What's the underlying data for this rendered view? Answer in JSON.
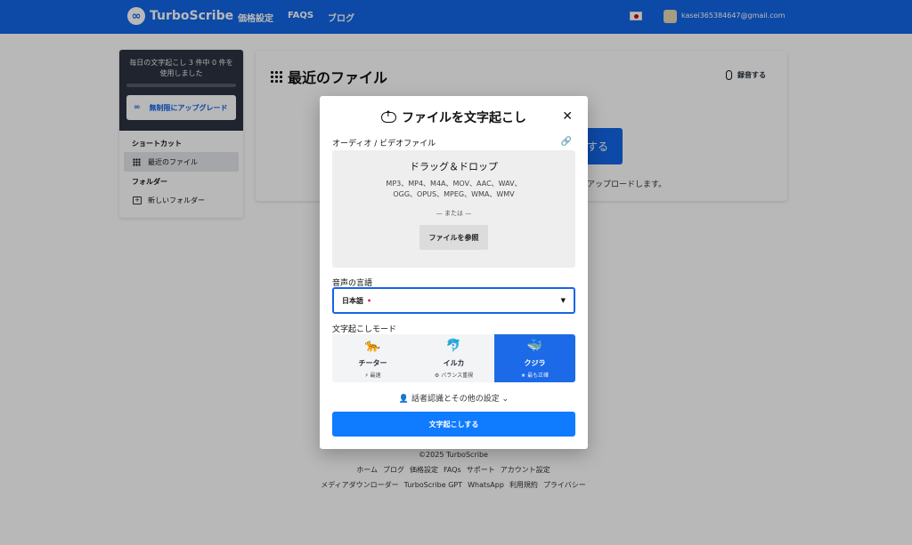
{
  "nav": {
    "brand": "TurboScribe",
    "links": [
      "価格設定",
      "FAQS",
      "ブログ"
    ],
    "email": "kasei365384647@gmail.com"
  },
  "sidebar": {
    "quota_text": "毎日の文字起こし 3 件中 0 件を使用しました",
    "upgrade_label": "無制限にアップグレード",
    "shortcuts_heading": "ショートカット",
    "recent_files": "最近のファイル",
    "folders_heading": "フォルダー",
    "new_folder": "新しいフォルダー"
  },
  "main": {
    "title": "最近のファイル",
    "record_label": "録音する",
    "upload_button_partial": "する",
    "upload_note_partial": "アップロードします。"
  },
  "footer": {
    "copyright": "©2025 TurboScribe",
    "row1": [
      "ホーム",
      "ブログ",
      "価格設定",
      "FAQs",
      "サポート",
      "アカウント設定"
    ],
    "row2": [
      "メディアダウンローダー",
      "TurboScribe GPT",
      "WhatsApp",
      "利用規約",
      "プライバシー"
    ]
  },
  "modal": {
    "title": "ファイルを文字起こし",
    "file_label": "オーディオ / ビデオファイル",
    "dropzone_title": "ドラッグ＆ドロップ",
    "formats": "MP3、MP4、M4A、MOV、AAC、WAV、OGG、OPUS、MPEG、WMA、WMV",
    "or_text": "— または —",
    "browse_label": "ファイルを参照",
    "language_label": "音声の言語",
    "language_value": "日本語",
    "mode_label": "文字起こしモード",
    "modes": [
      {
        "emoji": "🐆",
        "name": "チーター",
        "sub": "⚡ 最速"
      },
      {
        "emoji": "🐬",
        "name": "イルカ",
        "sub": "⚙ バランス重視"
      },
      {
        "emoji": "🐳",
        "name": "クジラ",
        "sub": "★ 最も正確"
      }
    ],
    "selected_mode": "クジラ",
    "speaker_settings": "👤 話者認識とその他の設定 ⌄",
    "submit_label": "文字起こしする"
  },
  "colors": {
    "primary": "#1266e6",
    "submit": "#0f7bff",
    "sidebar_dark": "#2b3340"
  }
}
